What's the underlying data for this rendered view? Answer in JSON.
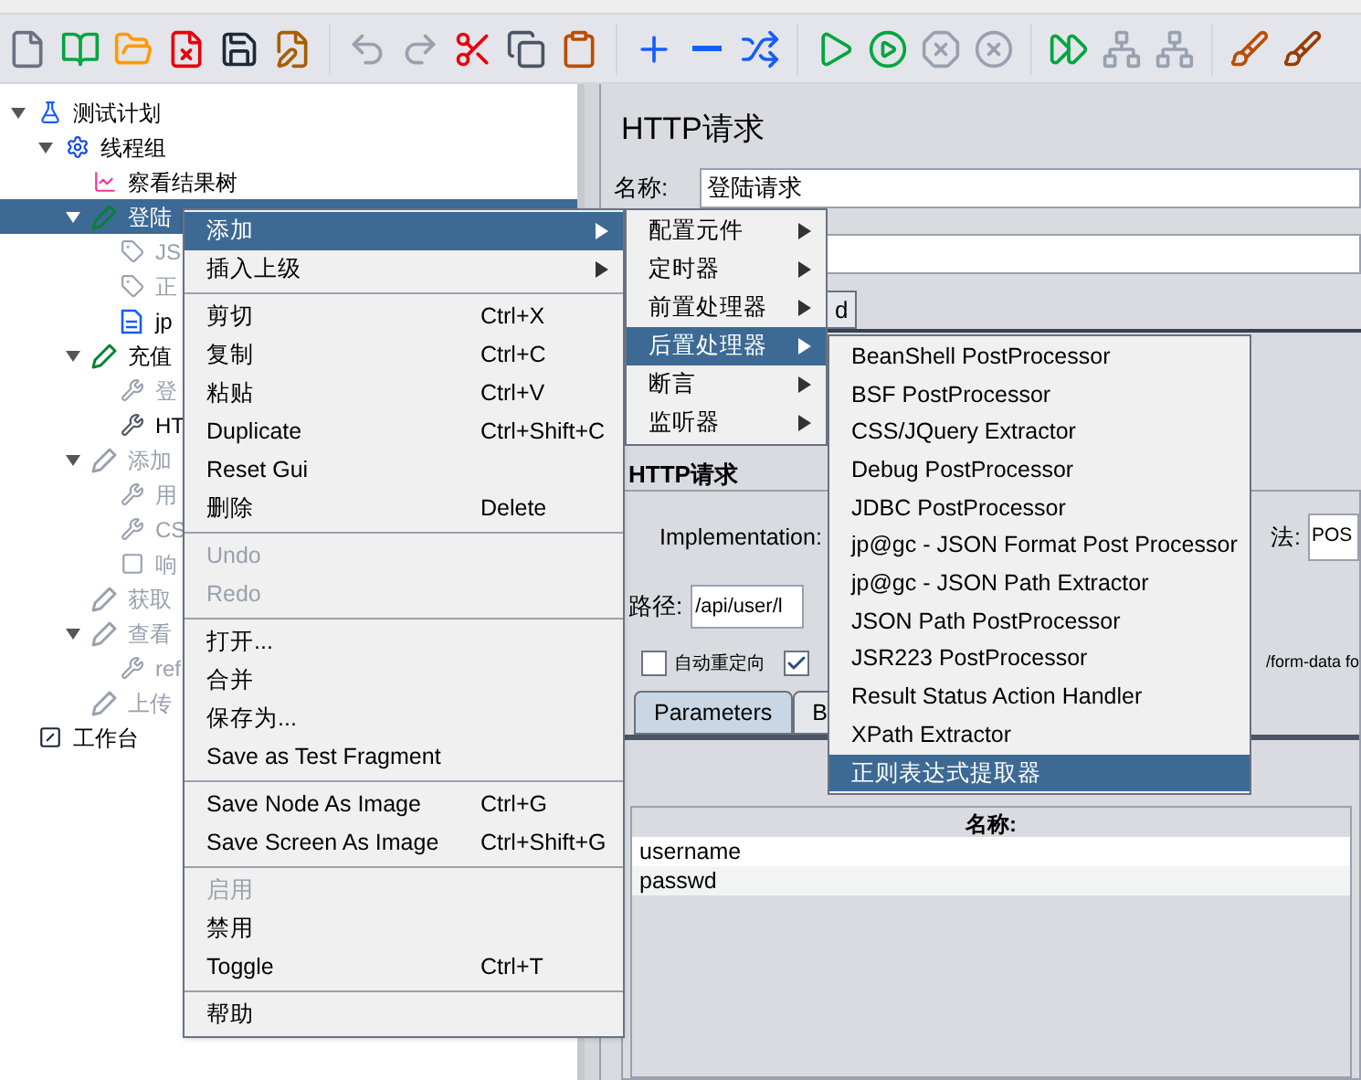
{
  "toolbar": [
    {
      "kind": "new",
      "disabled": false
    },
    {
      "kind": "templates",
      "disabled": false
    },
    {
      "kind": "open",
      "disabled": false
    },
    {
      "kind": "close",
      "disabled": false
    },
    {
      "kind": "save",
      "disabled": false
    },
    {
      "kind": "save_as",
      "disabled": false
    },
    {
      "kind": "separator"
    },
    {
      "kind": "undo",
      "disabled": true
    },
    {
      "kind": "redo",
      "disabled": true
    },
    {
      "kind": "cut",
      "disabled": false
    },
    {
      "kind": "copy",
      "disabled": false
    },
    {
      "kind": "paste",
      "disabled": false
    },
    {
      "kind": "separator"
    },
    {
      "kind": "expand",
      "disabled": false
    },
    {
      "kind": "collapse",
      "disabled": false
    },
    {
      "kind": "toggle",
      "disabled": false
    },
    {
      "kind": "separator"
    },
    {
      "kind": "start",
      "disabled": false
    },
    {
      "kind": "start_no_timers",
      "disabled": false
    },
    {
      "kind": "stop",
      "disabled": true
    },
    {
      "kind": "shutdown",
      "disabled": true
    },
    {
      "kind": "separator"
    },
    {
      "kind": "remote_start",
      "disabled": false
    },
    {
      "kind": "remote_stop",
      "disabled": true
    },
    {
      "kind": "remote_exit",
      "disabled": true
    },
    {
      "kind": "separator"
    },
    {
      "kind": "clear",
      "disabled": false
    },
    {
      "kind": "clear_all",
      "disabled": false
    }
  ],
  "tree": [
    {
      "label": "测试计划",
      "kind": "plan",
      "expanded": true,
      "selected": false,
      "disabled": false,
      "children": [
        {
          "label": "线程组",
          "kind": "threads",
          "expanded": true,
          "selected": false,
          "disabled": false,
          "children": [
            {
              "label": "察看结果树",
              "kind": "listener",
              "selected": false,
              "disabled": false
            },
            {
              "label": "登陆",
              "kind": "sampler",
              "expanded": true,
              "selected": true,
              "disabled": false,
              "children": [
                {
                  "label": "JS",
                  "kind": "tag",
                  "selected": false,
                  "disabled": true
                },
                {
                  "label": "正",
                  "kind": "tag",
                  "selected": false,
                  "disabled": true
                },
                {
                  "label": "jp",
                  "kind": "doc",
                  "selected": false,
                  "disabled": false
                }
              ]
            },
            {
              "label": "充值",
              "kind": "sampler",
              "expanded": true,
              "selected": false,
              "disabled": false,
              "children": [
                {
                  "label": "登",
                  "kind": "tool",
                  "selected": false,
                  "disabled": true
                },
                {
                  "label": "HT",
                  "kind": "tool",
                  "selected": false,
                  "disabled": false
                }
              ]
            },
            {
              "label": "添加",
              "kind": "sampler",
              "expanded": true,
              "selected": false,
              "disabled": true,
              "children": [
                {
                  "label": "用",
                  "kind": "tool",
                  "selected": false,
                  "disabled": true
                },
                {
                  "label": "CS",
                  "kind": "tool",
                  "selected": false,
                  "disabled": true
                },
                {
                  "label": "响",
                  "kind": "block",
                  "selected": false,
                  "disabled": true
                }
              ]
            },
            {
              "label": "获取",
              "kind": "sampler",
              "selected": false,
              "disabled": true
            },
            {
              "label": "查看",
              "kind": "sampler",
              "expanded": true,
              "selected": false,
              "disabled": true,
              "children": [
                {
                  "label": "ref",
                  "kind": "tool",
                  "selected": false,
                  "disabled": true
                }
              ]
            },
            {
              "label": "上传",
              "kind": "sampler",
              "selected": false,
              "disabled": true
            }
          ]
        }
      ]
    },
    {
      "label": "工作台",
      "kind": "workbench",
      "selected": false,
      "disabled": false
    }
  ],
  "editor": {
    "title": "HTTP请求",
    "name_label": "名称:",
    "name_value": "登陆请求",
    "tab_fragment": "d",
    "section_title": "HTTP请求",
    "implementation_label": "Implementation:",
    "method_label": "法:",
    "method_value": "POS",
    "path_label": "路径:",
    "path_value": "/api/user/l",
    "checkboxes": [
      {
        "label": "自动重定向",
        "checked": false
      },
      {
        "checked": true
      }
    ],
    "multipart_fragment": "/form-data fo",
    "tabs": [
      {
        "label": "Parameters",
        "selected": true
      },
      {
        "label": "B",
        "selected": false
      }
    ],
    "table": {
      "column": "名称:",
      "rows": [
        "username",
        "passwd"
      ]
    }
  },
  "context_menu": [
    {
      "kind": "item",
      "label": "添加",
      "has_submenu": true,
      "selected": true,
      "disabled": false
    },
    {
      "kind": "item",
      "label": "插入上级",
      "has_submenu": true,
      "selected": false,
      "disabled": false
    },
    {
      "kind": "separator"
    },
    {
      "kind": "item",
      "label": "剪切",
      "shortcut": "Ctrl+X",
      "has_submenu": false,
      "selected": false,
      "disabled": false
    },
    {
      "kind": "item",
      "label": "复制",
      "shortcut": "Ctrl+C",
      "has_submenu": false,
      "selected": false,
      "disabled": false
    },
    {
      "kind": "item",
      "label": "粘贴",
      "shortcut": "Ctrl+V",
      "has_submenu": false,
      "selected": false,
      "disabled": false
    },
    {
      "kind": "item",
      "label": "Duplicate",
      "shortcut": "Ctrl+Shift+C",
      "has_submenu": false,
      "selected": false,
      "disabled": false
    },
    {
      "kind": "item",
      "label": "Reset Gui",
      "has_submenu": false,
      "selected": false,
      "disabled": false
    },
    {
      "kind": "item",
      "label": "删除",
      "shortcut": "Delete",
      "has_submenu": false,
      "selected": false,
      "disabled": false
    },
    {
      "kind": "separator"
    },
    {
      "kind": "item",
      "label": "Undo",
      "has_submenu": false,
      "selected": false,
      "disabled": true
    },
    {
      "kind": "item",
      "label": "Redo",
      "has_submenu": false,
      "selected": false,
      "disabled": true
    },
    {
      "kind": "separator"
    },
    {
      "kind": "item",
      "label": "打开...",
      "has_submenu": false,
      "selected": false,
      "disabled": false
    },
    {
      "kind": "item",
      "label": "合并",
      "has_submenu": false,
      "selected": false,
      "disabled": false
    },
    {
      "kind": "item",
      "label": "保存为...",
      "has_submenu": false,
      "selected": false,
      "disabled": false
    },
    {
      "kind": "item",
      "label": "Save as Test Fragment",
      "has_submenu": false,
      "selected": false,
      "disabled": false
    },
    {
      "kind": "separator"
    },
    {
      "kind": "item",
      "label": "Save Node As Image",
      "shortcut": "Ctrl+G",
      "has_submenu": false,
      "selected": false,
      "disabled": false
    },
    {
      "kind": "item",
      "label": "Save Screen As Image",
      "shortcut": "Ctrl+Shift+G",
      "has_submenu": false,
      "selected": false,
      "disabled": false
    },
    {
      "kind": "separator"
    },
    {
      "kind": "item",
      "label": "启用",
      "has_submenu": false,
      "selected": false,
      "disabled": true
    },
    {
      "kind": "item",
      "label": "禁用",
      "has_submenu": false,
      "selected": false,
      "disabled": false
    },
    {
      "kind": "item",
      "label": "Toggle",
      "shortcut": "Ctrl+T",
      "has_submenu": false,
      "selected": false,
      "disabled": false
    },
    {
      "kind": "separator"
    },
    {
      "kind": "item",
      "label": "帮助",
      "has_submenu": false,
      "selected": false,
      "disabled": false
    }
  ],
  "add_submenu": [
    {
      "label": "配置元件",
      "selected": false
    },
    {
      "label": "定时器",
      "selected": false
    },
    {
      "label": "前置处理器",
      "selected": false
    },
    {
      "label": "后置处理器",
      "selected": true
    },
    {
      "label": "断言",
      "selected": false
    },
    {
      "label": "监听器",
      "selected": false
    }
  ],
  "postprocessor_submenu": [
    {
      "label": "BeanShell PostProcessor",
      "selected": false
    },
    {
      "label": "BSF PostProcessor",
      "selected": false
    },
    {
      "label": "CSS/JQuery Extractor",
      "selected": false
    },
    {
      "label": "Debug PostProcessor",
      "selected": false
    },
    {
      "label": "JDBC PostProcessor",
      "selected": false
    },
    {
      "label": "jp@gc - JSON Format Post Processor",
      "selected": false
    },
    {
      "label": "jp@gc - JSON Path Extractor",
      "selected": false
    },
    {
      "label": "JSON Path PostProcessor",
      "selected": false
    },
    {
      "label": "JSR223 PostProcessor",
      "selected": false
    },
    {
      "label": "Result Status Action Handler",
      "selected": false
    },
    {
      "label": "XPath Extractor",
      "selected": false
    },
    {
      "label": "正则表达式提取器",
      "selected": true
    }
  ]
}
